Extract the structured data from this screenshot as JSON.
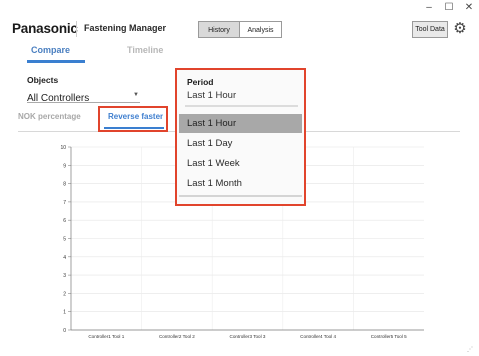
{
  "window": {
    "minimize": "–",
    "maximize": "☐",
    "close": "✕"
  },
  "header": {
    "brand": "Panasonic",
    "app_title": "Fastening Manager",
    "view_toggle": [
      "History",
      "Analysis"
    ],
    "tool_data": "Tool Data",
    "settings_icon": "gear-icon"
  },
  "tabs": [
    {
      "label": "Compare",
      "active": true
    },
    {
      "label": "Timeline",
      "active": false
    }
  ],
  "objects": {
    "label": "Objects",
    "value": "All Controllers"
  },
  "subtabs": [
    {
      "label": "NOK percentage",
      "active": false
    },
    {
      "label": "Reverse fasten",
      "active": true
    }
  ],
  "period": {
    "label": "Period",
    "value": "Last 1 Hour",
    "options": [
      "Last 1 Hour",
      "Last 1 Day",
      "Last 1 Week",
      "Last 1 Month"
    ],
    "selected": 0
  },
  "colors": {
    "accent": "#3a7fd0",
    "highlight": "#e1442c",
    "inactive_tab": "#b8b8b8"
  },
  "chart_data": {
    "type": "bar",
    "categories": [
      "Controller1 Tool 1",
      "Controller2 Tool 2",
      "Controller3 Tool 3",
      "Controller4 Tool 4",
      "Controller5 Tool 5"
    ],
    "values": [
      0,
      0,
      0,
      0,
      0
    ],
    "yticks": [
      "0",
      "1",
      "2",
      "3",
      "4",
      "5",
      "6",
      "7",
      "8",
      "9",
      "10"
    ],
    "ylim": [
      0,
      10
    ],
    "grid": true
  }
}
